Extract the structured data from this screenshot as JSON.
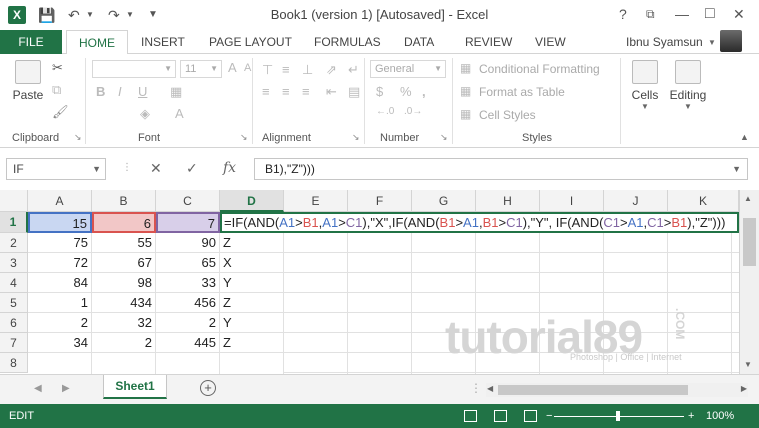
{
  "titlebar": {
    "app_icon": "X",
    "title": "Book1 (version 1) [Autosaved] - Excel",
    "help": "?",
    "restore": "⧉",
    "minimize": "—",
    "maximize": "□",
    "close": "✕"
  },
  "tabs": {
    "file": "FILE",
    "items": [
      "HOME",
      "INSERT",
      "PAGE LAYOUT",
      "FORMULAS",
      "DATA",
      "REVIEW",
      "VIEW"
    ],
    "user": "Ibnu Syamsun"
  },
  "ribbon": {
    "paste": "Paste",
    "font_size": "11",
    "number_format": "General",
    "conditional_formatting": "Conditional Formatting",
    "format_as_table": "Format as Table",
    "cell_styles": "Cell Styles",
    "cells": "Cells",
    "editing": "Editing",
    "groups": [
      "Clipboard",
      "Font",
      "Alignment",
      "Number",
      "Styles"
    ],
    "bold": "B",
    "italic": "I",
    "underline": "U",
    "currency": "$",
    "percent": "%",
    "comma": ",",
    "font_grow": "A",
    "font_shrink": "A",
    "font_color": "A",
    "fx": "fx"
  },
  "formula_bar": {
    "name_box": "IF",
    "content": "B1),\"Z\")))"
  },
  "grid": {
    "columns": [
      "A",
      "B",
      "C",
      "D",
      "E",
      "F",
      "G",
      "H",
      "I",
      "J",
      "K"
    ],
    "rows": [
      "1",
      "2",
      "3",
      "4",
      "5",
      "6",
      "7",
      "8"
    ],
    "selected_column": "D",
    "selected_row": "1",
    "data": [
      [
        "15",
        "6",
        "7"
      ],
      [
        "75",
        "55",
        "90",
        "Z"
      ],
      [
        "72",
        "67",
        "65",
        "X"
      ],
      [
        "84",
        "98",
        "33",
        "Y"
      ],
      [
        "1",
        "434",
        "456",
        "Z"
      ],
      [
        "2",
        "32",
        "2",
        "Y"
      ],
      [
        "34",
        "2",
        "445",
        "Z"
      ]
    ],
    "formula_parts": [
      "=IF(AND(",
      "A1",
      ">",
      "B1",
      ",",
      "A1",
      ">",
      "C1",
      "),\"X\",IF(AND(",
      "B1",
      ">",
      "A1",
      ",",
      "B1",
      ">",
      "C1",
      "),\"Y\", IF(AND(",
      "C1",
      ">",
      "A1",
      ",",
      "C1",
      ">",
      "B1",
      "),\"Z\")))"
    ]
  },
  "watermark": {
    "main": "tutorial89",
    "sub": "Photoshop | Office | Internet",
    "com": ".COM"
  },
  "sheets": {
    "active": "Sheet1",
    "add": "+"
  },
  "status": {
    "mode": "EDIT",
    "zoom": "100%"
  },
  "colors": {
    "excel_green": "#217346",
    "ref_a": "#4472c4",
    "ref_b": "#d9534f",
    "ref_c": "#8064a2"
  }
}
